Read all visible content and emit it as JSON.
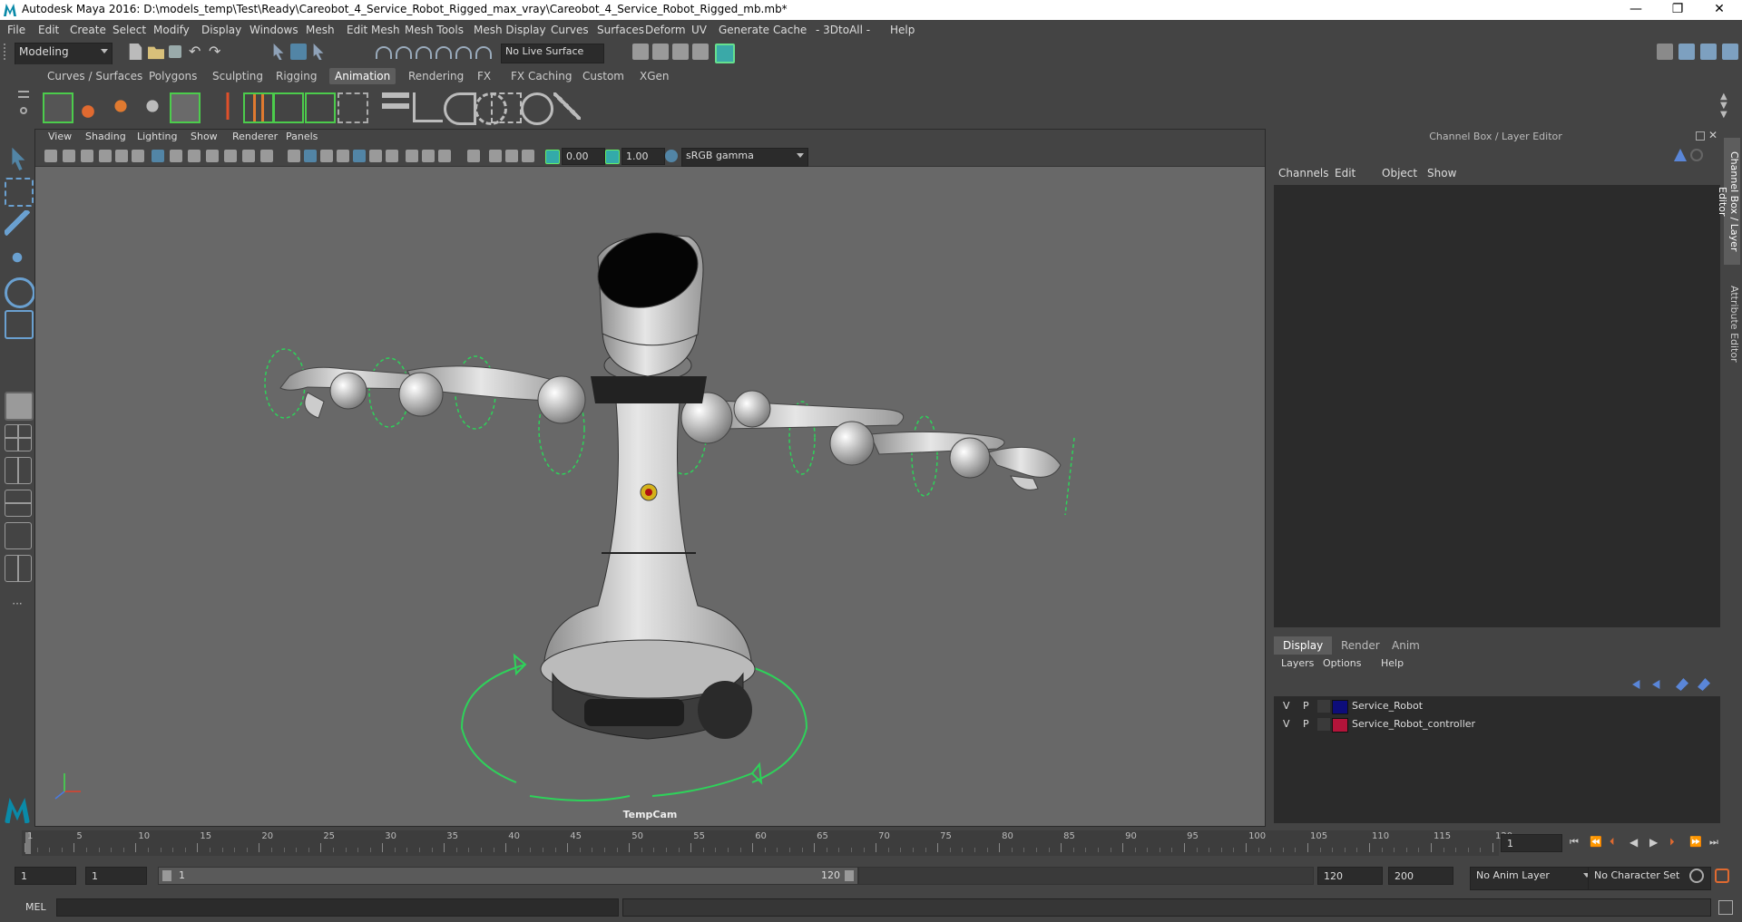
{
  "window": {
    "title": "Autodesk Maya 2016: D:\\models_temp\\Test\\Ready\\Careobot_4_Service_Robot_Rigged_max_vray\\Careobot_4_Service_Robot_Rigged_mb.mb*",
    "minimize": "—",
    "maximize": "❐",
    "close": "✕"
  },
  "menubar": [
    "File",
    "Edit",
    "Create",
    "Select",
    "Modify",
    "Display",
    "Windows",
    "Mesh",
    "Edit Mesh",
    "Mesh Tools",
    "Mesh Display",
    "Curves",
    "Surfaces",
    "Deform",
    "UV",
    "Generate",
    "Cache",
    "- 3DtoAll -",
    "Help"
  ],
  "statusline": {
    "mode": "Modeling",
    "live_surface": "No Live Surface"
  },
  "shelf_tabs": [
    "Curves / Surfaces",
    "Polygons",
    "Sculpting",
    "Rigging",
    "Animation",
    "Rendering",
    "FX",
    "FX Caching",
    "Custom",
    "XGen"
  ],
  "shelf_active": "Animation",
  "viewport": {
    "menu": [
      "View",
      "Shading",
      "Lighting",
      "Show",
      "Renderer",
      "Panels"
    ],
    "exposure": "0.00",
    "gamma": "1.00",
    "color_space": "sRGB gamma",
    "camera": "TempCam"
  },
  "channelbox": {
    "title": "Channel Box / Layer Editor",
    "menu": [
      "Channels",
      "Edit",
      "Object",
      "Show"
    ],
    "layer_tabs": [
      "Display",
      "Render",
      "Anim"
    ],
    "layer_menu": [
      "Layers",
      "Options",
      "Help"
    ],
    "layers": [
      {
        "v": "V",
        "p": "P",
        "name": "Service_Robot",
        "color": "#0d0d7a"
      },
      {
        "v": "V",
        "p": "P",
        "name": "Service_Robot_controller",
        "color": "#b3143a"
      }
    ]
  },
  "side_tabs": [
    "Channel Box / Layer Editor",
    "Attribute Editor"
  ],
  "timeslider": {
    "ticks": [
      "1",
      "5",
      "10",
      "15",
      "20",
      "25",
      "30",
      "35",
      "40",
      "45",
      "50",
      "55",
      "60",
      "65",
      "70",
      "75",
      "80",
      "85",
      "90",
      "95",
      "100",
      "105",
      "110",
      "115",
      "120"
    ],
    "current_frame": "1"
  },
  "rangeslider": {
    "start": "1",
    "range_start": "1",
    "range_handle_start": "1",
    "range_handle_end": "120",
    "end": "120",
    "anim_end": "200",
    "anim_layer": "No Anim Layer",
    "character_set": "No Character Set"
  },
  "cmdline": {
    "label": "MEL"
  }
}
